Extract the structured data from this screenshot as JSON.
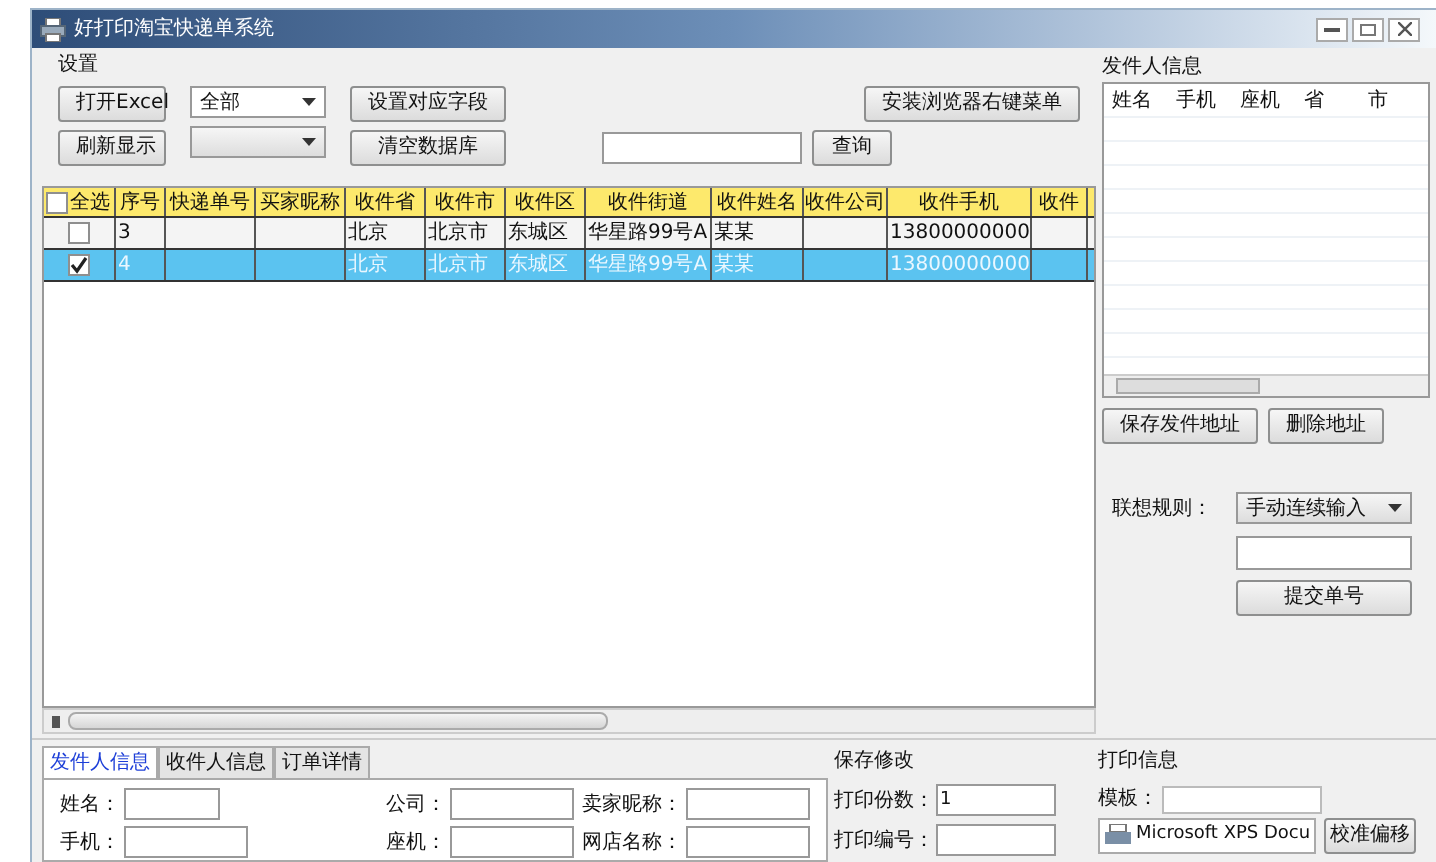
{
  "window": {
    "title": "好打印淘宝快递单系统"
  },
  "settings": {
    "title": "设置",
    "open_excel": "打开Excel",
    "refresh": "刷新显示",
    "filter_select": "全部",
    "map_fields": "设置对应字段",
    "clear_db": "清空数据库",
    "install_menu": "安装浏览器右键菜单",
    "search_button": "查询"
  },
  "table": {
    "select_all": {
      "label": "全选",
      "checked": false
    },
    "columns": [
      "序号",
      "快递单号",
      "买家昵称",
      "收件省",
      "收件市",
      "收件区",
      "收件街道",
      "收件姓名",
      "收件公司",
      "收件手机",
      "收件"
    ],
    "rows": [
      {
        "checked": false,
        "selected": false,
        "cells": [
          "3",
          "",
          "",
          "北京",
          "北京市",
          "东城区",
          "华星路99号A",
          "某某",
          "",
          "13800000000",
          ""
        ]
      },
      {
        "checked": true,
        "selected": true,
        "cells": [
          "4",
          "",
          "",
          "北京",
          "北京市",
          "东城区",
          "华星路99号A",
          "某某",
          "",
          "13800000000",
          ""
        ]
      }
    ]
  },
  "sender_panel": {
    "title": "发件人信息",
    "columns": [
      "姓名",
      "手机",
      "座机",
      "省",
      "市"
    ],
    "buttons": [
      "保存发件地址",
      "删除地址"
    ]
  },
  "association": {
    "label": "联想规则：",
    "value": "手动连续输入",
    "submit": "提交单号"
  },
  "tabs": [
    {
      "label": "发件人信息",
      "selected": true
    },
    {
      "label": "收件人信息",
      "selected": false
    },
    {
      "label": "订单详情",
      "selected": false
    }
  ],
  "sender_form": {
    "fields": [
      {
        "label": "姓名："
      },
      {
        "label": "公司："
      },
      {
        "label": "卖家昵称："
      },
      {
        "label": "手机："
      },
      {
        "label": "座机："
      },
      {
        "label": "网店名称："
      }
    ]
  },
  "save_panel": {
    "title": "保存修改",
    "fields": [
      {
        "label": "打印份数：",
        "value": "1"
      },
      {
        "label": "打印编号："
      }
    ]
  },
  "print_panel": {
    "title": "打印信息",
    "template_label": "模板：",
    "printer": "Microsoft XPS Docu",
    "calibrate": "校准偏移"
  }
}
